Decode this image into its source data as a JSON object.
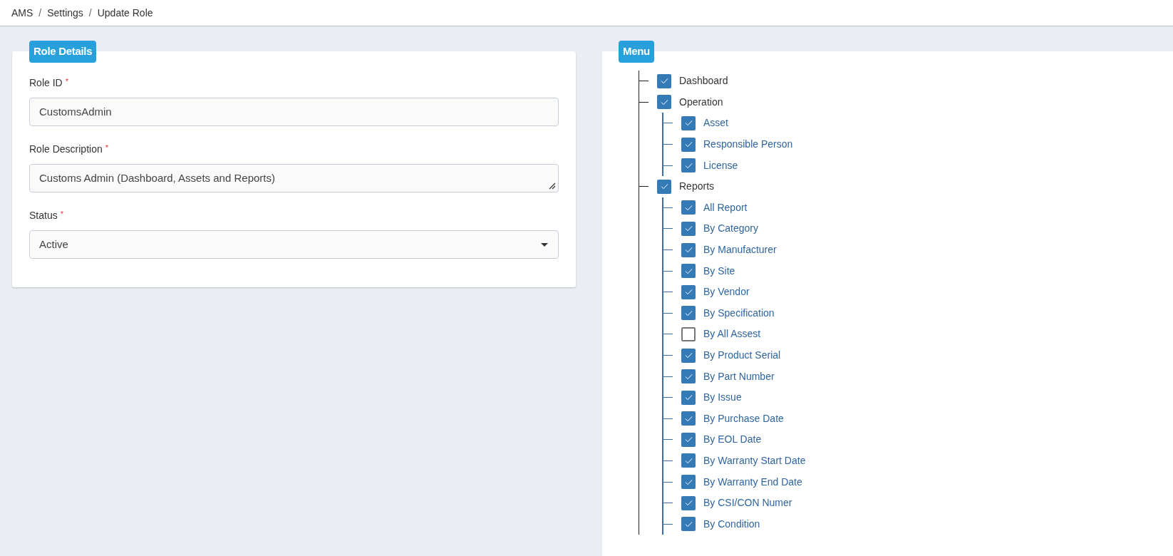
{
  "breadcrumb": {
    "separator": "/",
    "items": [
      "AMS",
      "Settings",
      "Update Role"
    ]
  },
  "role_details": {
    "title": "Role Details",
    "fields": [
      {
        "kind": "input",
        "label": "Role ID",
        "required_mark": "*",
        "value": "CustomsAdmin"
      },
      {
        "kind": "textarea",
        "label": "Role Description",
        "required_mark": "*",
        "value": "Customs Admin (Dashboard, Assets and Reports)"
      },
      {
        "kind": "select",
        "label": "Status",
        "required_mark": "*",
        "value": "Active"
      }
    ]
  },
  "menu": {
    "title": "Menu",
    "items": [
      {
        "label": "Dashboard",
        "checked": true
      },
      {
        "label": "Operation",
        "checked": true,
        "children": [
          {
            "label": "Asset",
            "checked": true
          },
          {
            "label": "Responsible Person",
            "checked": true
          },
          {
            "label": "License",
            "checked": true
          }
        ]
      },
      {
        "label": "Reports",
        "checked": true,
        "children": [
          {
            "label": "All Report",
            "checked": true
          },
          {
            "label": "By Category",
            "checked": true
          },
          {
            "label": "By Manufacturer",
            "checked": true
          },
          {
            "label": "By Site",
            "checked": true
          },
          {
            "label": "By Vendor",
            "checked": true
          },
          {
            "label": "By Specification",
            "checked": true
          },
          {
            "label": "By All Assest",
            "checked": false
          },
          {
            "label": "By Product Serial",
            "checked": true
          },
          {
            "label": "By Part Number",
            "checked": true
          },
          {
            "label": "By Issue",
            "checked": true
          },
          {
            "label": "By Purchase Date",
            "checked": true
          },
          {
            "label": "By EOL Date",
            "checked": true
          },
          {
            "label": "By Warranty Start Date",
            "checked": true
          },
          {
            "label": "By Warranty End Date",
            "checked": true
          },
          {
            "label": "By CSI/CON Numer",
            "checked": true
          },
          {
            "label": "By Condition",
            "checked": true
          }
        ]
      }
    ]
  }
}
